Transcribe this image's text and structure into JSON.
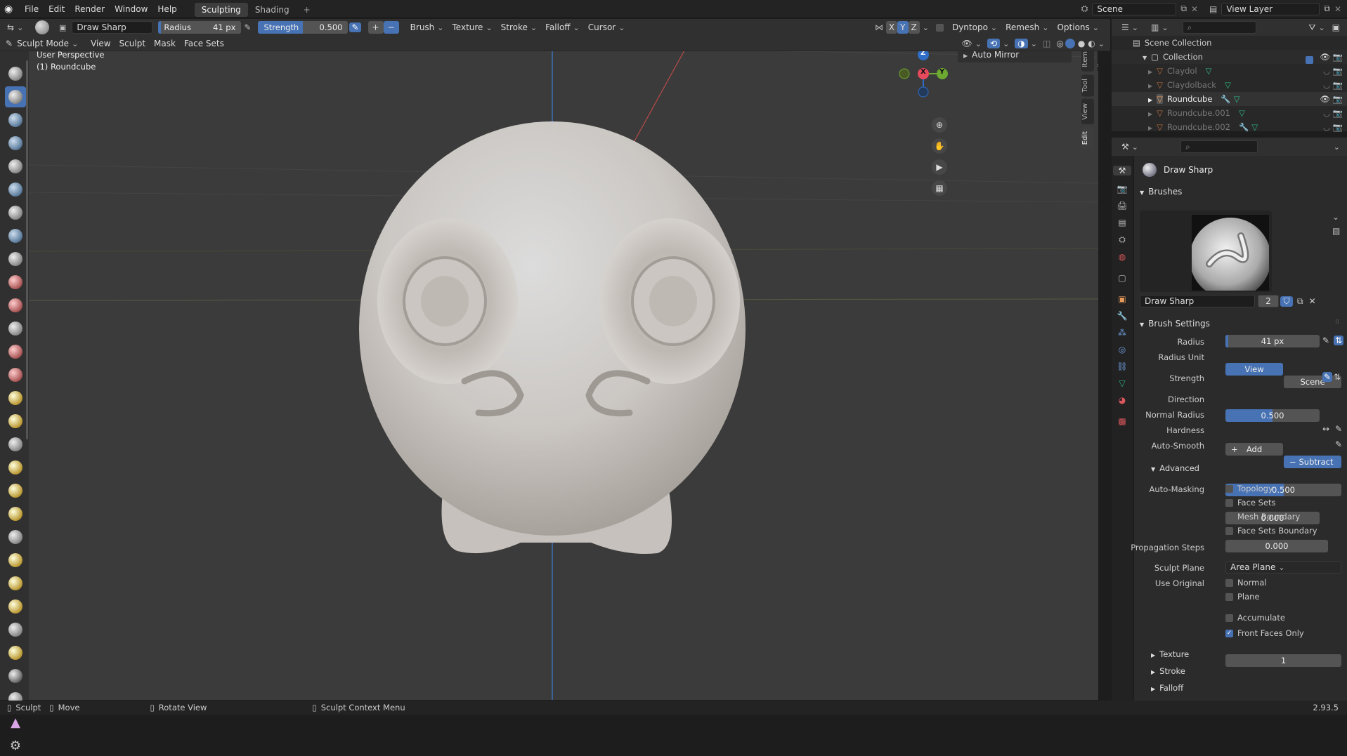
{
  "topbar": {
    "menus": [
      "File",
      "Edit",
      "Render",
      "Window",
      "Help"
    ],
    "workspace_tabs": [
      "Sculpting",
      "Shading"
    ],
    "active_tab": "Sculpting",
    "add_tab": "+",
    "scene": "Scene",
    "view_layer": "View Layer"
  },
  "toolsettings": {
    "brush_name": "Draw Sharp",
    "radius_label": "Radius",
    "radius_value": "41 px",
    "strength_label": "Strength",
    "strength_value": "0.500",
    "plus": "+",
    "minus": "−",
    "menus": [
      "Brush",
      "Texture",
      "Stroke",
      "Falloff",
      "Cursor"
    ],
    "axes": [
      "X",
      "Y",
      "Z"
    ],
    "dyntopo": "Dyntopo",
    "remesh": "Remesh",
    "options": "Options"
  },
  "header2": {
    "mode": "Sculpt Mode",
    "menus": [
      "View",
      "Sculpt",
      "Mask",
      "Face Sets"
    ]
  },
  "viewport": {
    "perspective": "User Perspective",
    "object": "(1) Roundcube",
    "auto_mirror": "Auto Mirror",
    "gizmo_axes": [
      "Z",
      "X",
      "Y"
    ],
    "npanel_tabs": [
      "Item",
      "Tool",
      "View",
      "Edit"
    ]
  },
  "outliner": {
    "scene_collection": "Scene Collection",
    "collection": "Collection",
    "items": [
      "Claydol",
      "Claydolback",
      "Roundcube",
      "Roundcube.001",
      "Roundcube.002"
    ]
  },
  "properties": {
    "brush_title": "Draw Sharp",
    "brushes_section": "Brushes",
    "brush_field": "Draw Sharp",
    "brush_users": "2",
    "brush_settings": "Brush Settings",
    "radius_label": "Radius",
    "radius_value": "41 px",
    "radius_unit_label": "Radius Unit",
    "radius_unit_view": "View",
    "radius_unit_scene": "Scene",
    "strength_label": "Strength",
    "strength_value": "0.500",
    "direction_label": "Direction",
    "direction_add": "Add",
    "direction_subtract": "Subtract",
    "normal_radius_label": "Normal Radius",
    "normal_radius_value": "0.500",
    "hardness_label": "Hardness",
    "hardness_value": "0.000",
    "autosmooth_label": "Auto-Smooth",
    "autosmooth_value": "0.000",
    "advanced": "Advanced",
    "automasking_label": "Auto-Masking",
    "automasking": [
      "Topology",
      "Face Sets",
      "Mesh Boundary",
      "Face Sets Boundary"
    ],
    "propagation_label": "Propagation Steps",
    "propagation_value": "1",
    "sculpt_plane_label": "Sculpt Plane",
    "sculpt_plane_value": "Area Plane",
    "use_original_label": "Use Original",
    "use_original": [
      "Normal",
      "Plane"
    ],
    "accumulate": "Accumulate",
    "front_faces": "Front Faces Only",
    "texture": "Texture",
    "stroke": "Stroke",
    "falloff": "Falloff"
  },
  "status": {
    "sculpt": "Sculpt",
    "move": "Move",
    "rotate": "Rotate View",
    "context": "Sculpt Context Menu",
    "version": "2.93.5"
  },
  "colors": {
    "accent": "#4772b3",
    "viewport_bg": "#3b3b3b",
    "mesh": "#cfcac6"
  }
}
